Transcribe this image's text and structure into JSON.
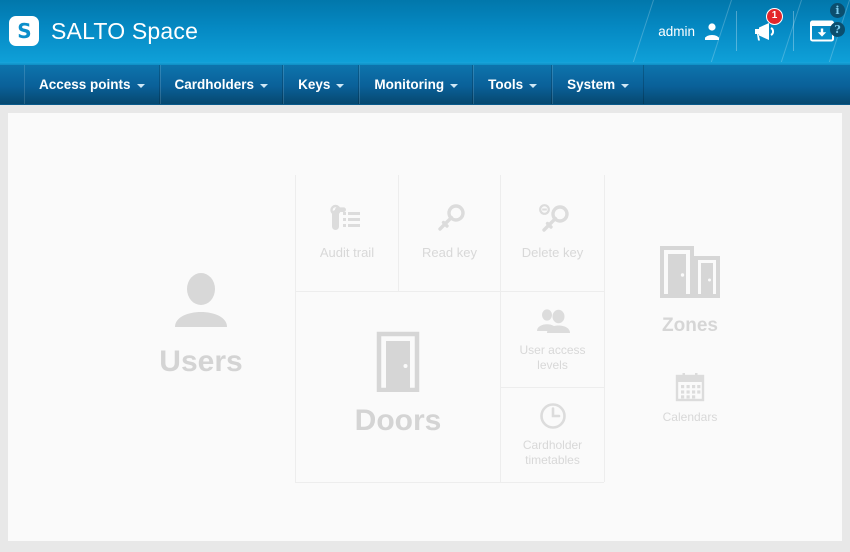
{
  "header": {
    "logo_letter": "S",
    "app_title": "SALTO Space",
    "user_name": "admin",
    "user_icon": "user-avatar-icon",
    "announcement_icon": "megaphone-icon",
    "announcement_badge": "1",
    "download_icon": "window-download-icon",
    "info_icon": "i",
    "help_icon": "?",
    "accent_color": "#0b9dd7",
    "badge_color": "#e3262b"
  },
  "nav": {
    "items": [
      {
        "label": "Access points"
      },
      {
        "label": "Cardholders"
      },
      {
        "label": "Keys"
      },
      {
        "label": "Monitoring"
      },
      {
        "label": "Tools"
      },
      {
        "label": "System"
      }
    ]
  },
  "main": {
    "tiles": [
      {
        "id": "users",
        "label": "Users",
        "icon": "person-icon"
      },
      {
        "id": "audit-trail",
        "label": "Audit trail",
        "icon": "door-handle-list-icon"
      },
      {
        "id": "read-key",
        "label": "Read key",
        "icon": "key-icon"
      },
      {
        "id": "delete-key",
        "label": "Delete key",
        "icon": "key-minus-icon"
      },
      {
        "id": "zones",
        "label": "Zones",
        "icon": "two-doors-icon"
      },
      {
        "id": "doors",
        "label": "Doors",
        "icon": "door-icon"
      },
      {
        "id": "user-access-levels",
        "label": "User access levels",
        "icon": "two-people-icon"
      },
      {
        "id": "calendars",
        "label": "Calendars",
        "icon": "calendar-icon"
      },
      {
        "id": "cardholder-timetables",
        "label": "Cardholder timetables",
        "icon": "clock-icon"
      }
    ]
  }
}
